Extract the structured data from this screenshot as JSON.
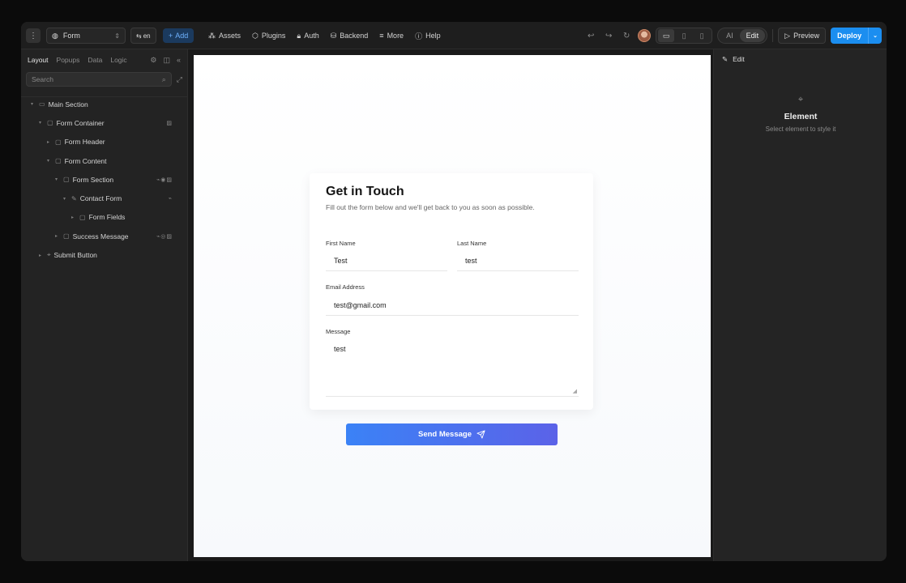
{
  "toolbar": {
    "page_select": "Form",
    "lang": "en",
    "add": "Add",
    "nav": [
      {
        "icon": "assets-icon",
        "label": "Assets"
      },
      {
        "icon": "plugins-icon",
        "label": "Plugins"
      },
      {
        "icon": "lock-icon",
        "label": "Auth"
      },
      {
        "icon": "database-icon",
        "label": "Backend"
      },
      {
        "icon": "more-icon",
        "label": "More"
      },
      {
        "icon": "help-icon",
        "label": "Help"
      }
    ],
    "modes": [
      "AI",
      "Edit"
    ],
    "active_mode": "Edit",
    "preview": "Preview",
    "deploy": "Deploy"
  },
  "sidebar": {
    "tabs": [
      "Layout",
      "Popups",
      "Data",
      "Logic"
    ],
    "active_tab": "Layout",
    "search_placeholder": "Search",
    "tree": [
      {
        "label": "Main Section",
        "depth": 0,
        "expanded": true,
        "icon": "section-icon",
        "badges": ""
      },
      {
        "label": "Form Container",
        "depth": 1,
        "expanded": true,
        "icon": "box-icon",
        "badges": "▨"
      },
      {
        "label": "Form Header",
        "depth": 2,
        "expanded": false,
        "icon": "box-icon",
        "badges": ""
      },
      {
        "label": "Form Content",
        "depth": 2,
        "expanded": true,
        "icon": "box-icon",
        "badges": ""
      },
      {
        "label": "Form Section",
        "depth": 3,
        "expanded": true,
        "icon": "box-icon",
        "badges": "⌁◉▨"
      },
      {
        "label": "Contact Form",
        "depth": 4,
        "expanded": true,
        "icon": "pencil-icon",
        "badges": "⌁"
      },
      {
        "label": "Form Fields",
        "depth": 5,
        "expanded": false,
        "icon": "box-icon",
        "badges": ""
      },
      {
        "label": "Success Message",
        "depth": 3,
        "expanded": false,
        "icon": "box-icon",
        "badges": "⌁◎▨"
      },
      {
        "label": "Submit Button",
        "depth": 1,
        "expanded": false,
        "icon": "cursor-icon",
        "badges": ""
      }
    ]
  },
  "form": {
    "title": "Get in Touch",
    "subtitle": "Fill out the form below and we'll get back to you as soon as possible.",
    "first_name_label": "First Name",
    "first_name_value": "Test",
    "last_name_label": "Last Name",
    "last_name_value": "test",
    "email_label": "Email Address",
    "email_value": "test@gmail.com",
    "message_label": "Message",
    "message_value": "test",
    "submit": "Send Message"
  },
  "style_panel": {
    "header": "Edit",
    "empty_title": "Element",
    "empty_sub": "Select element to style it"
  },
  "colors": {
    "accent": "#1b8ef0",
    "button_gradient_start": "#3b82f6",
    "button_gradient_end": "#5b62e8"
  }
}
